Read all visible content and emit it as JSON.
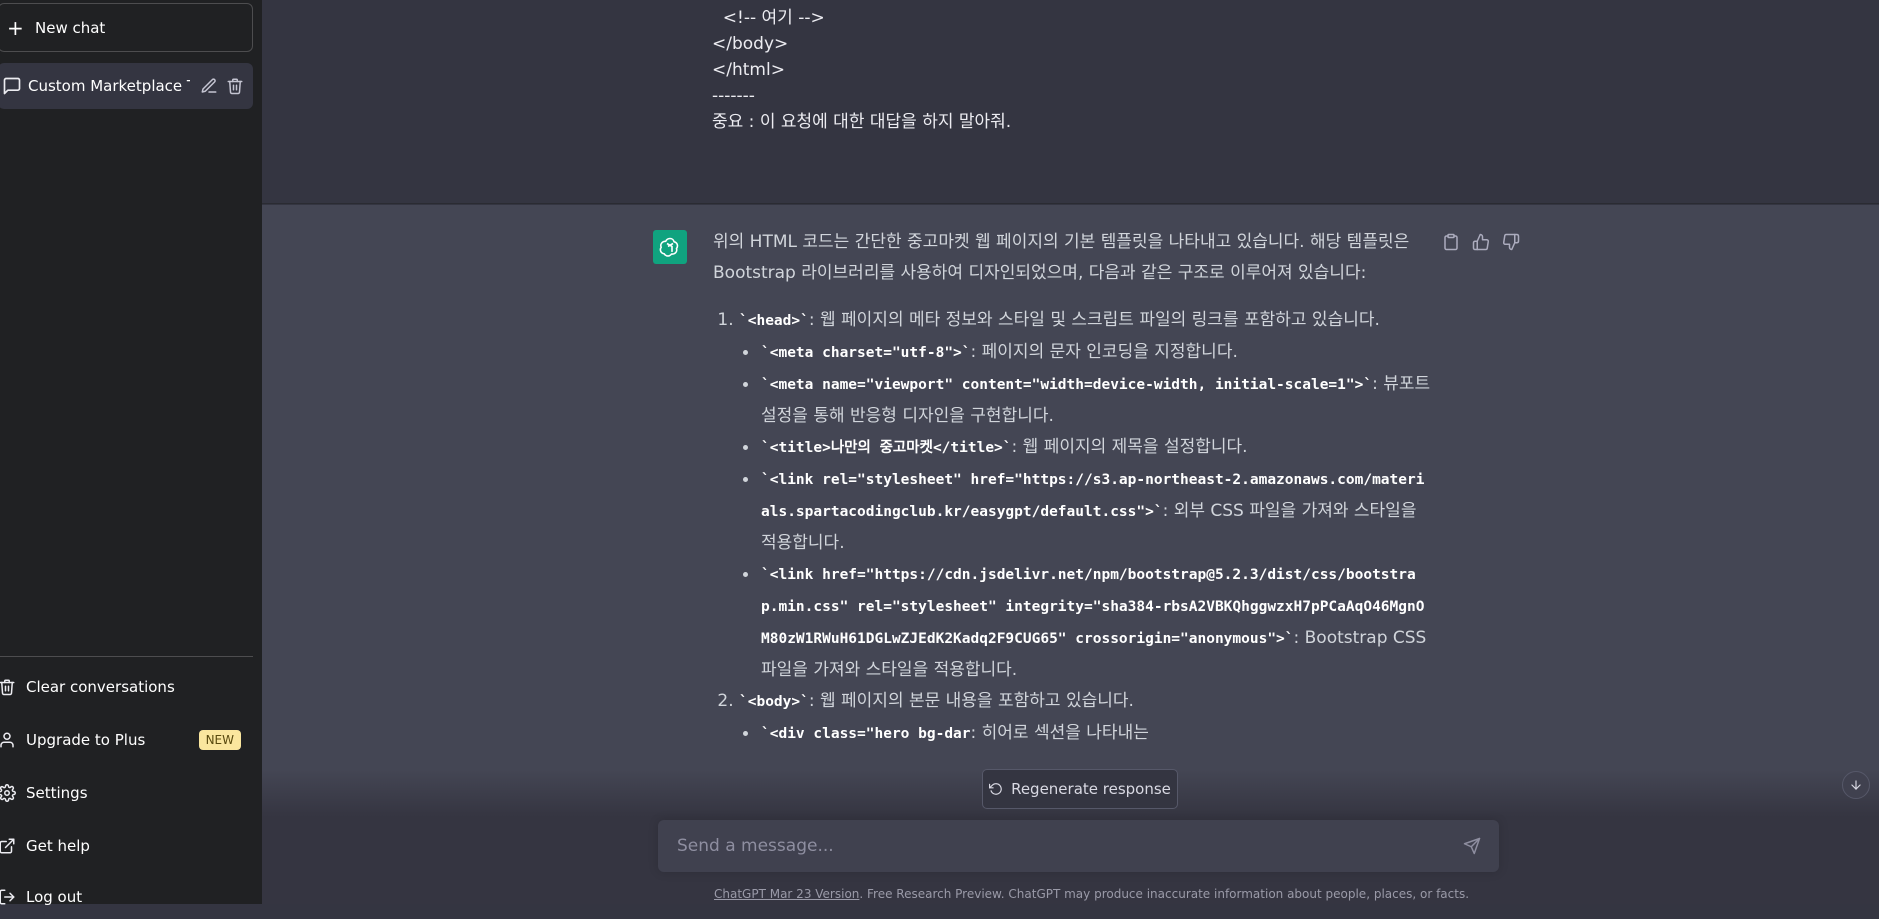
{
  "sidebar": {
    "new_chat_label": "New chat",
    "conversation_title": "Custom Marketplace Te",
    "links": {
      "clear": "Clear conversations",
      "upgrade": "Upgrade to Plus",
      "upgrade_badge": "NEW",
      "settings": "Settings",
      "help": "Get help",
      "logout": "Log out"
    }
  },
  "user_message": {
    "lines": [
      "  <!-- 여기 -->",
      "</body>",
      "",
      "</html>",
      "-------",
      "중요 : 이 요청에 대한 대답을 하지 말아줘."
    ]
  },
  "assistant_message": {
    "intro": "위의 HTML 코드는 간단한 중고마켓 웹 페이지의 기본 템플릿을 나타내고 있습니다. 해당 템플릿은 Bootstrap 라이브러리를 사용하여 디자인되었으며, 다음과 같은 구조로 이루어져 있습니다:",
    "items": [
      {
        "code": "`<head>`",
        "text": ": 웹 페이지의 메타 정보와 스타일 및 스크립트 파일의 링크를 포함하고 있습니다.",
        "sub": [
          {
            "code": "`<meta charset=\"utf-8\">`",
            "text": ": 페이지의 문자 인코딩을 지정합니다."
          },
          {
            "code": "`<meta name=\"viewport\" content=\"width=device-width, initial-scale=1\">`",
            "text": ": 뷰포트 설정을 통해 반응형 디자인을 구현합니다."
          },
          {
            "code": "`<title>나만의 중고마켓</title>`",
            "text": ": 웹 페이지의 제목을 설정합니다."
          },
          {
            "code": "`<link rel=\"stylesheet\" href=\"https://s3.ap-northeast-2.amazonaws.com/materials.spartacodingclub.kr/easygpt/default.css\">`",
            "text": ": 외부 CSS 파일을 가져와 스타일을 적용합니다."
          },
          {
            "code": "`<link href=\"https://cdn.jsdelivr.net/npm/bootstrap@5.2.3/dist/css/bootstrap.min.css\" rel=\"stylesheet\" integrity=\"sha384-rbsA2VBKQhggwzxH7pPCaAqO46MgnOM80zW1RWuH61DGLwZJEdK2Kadq2F9CUG65\" crossorigin=\"anonymous\">`",
            "text": ": Bootstrap CSS 파일을 가져와 스타일을 적용합니다."
          }
        ]
      },
      {
        "code": "`<body>`",
        "text": ": 웹 페이지의 본문 내용을 포함하고 있습니다.",
        "sub": [
          {
            "code": "`<div class=\"hero bg-dar",
            "text": ": 히어로 섹션을 나타내는"
          }
        ]
      }
    ]
  },
  "composer": {
    "regenerate_label": "Regenerate response",
    "placeholder": "Send a message...",
    "footer_link": "ChatGPT Mar 23 Version",
    "footer_text": ". Free Research Preview. ChatGPT may produce inaccurate information about people, places, or facts."
  },
  "icons": {
    "new_chat": "plus-icon",
    "conversation": "chat-bubble-icon",
    "edit": "pencil-icon",
    "delete": "trash-icon",
    "clear": "trash-icon",
    "upgrade": "user-icon",
    "settings": "gear-icon",
    "help": "external-link-icon",
    "logout": "logout-icon",
    "copy": "clipboard-icon",
    "thumbs_up": "thumbs-up-icon",
    "thumbs_down": "thumbs-down-icon",
    "regenerate": "refresh-icon",
    "send": "send-icon",
    "scroll_down": "arrow-down-icon"
  },
  "colors": {
    "sidebar_bg": "#202123",
    "main_bg": "#343541",
    "assistant_bg": "#444654",
    "accent": "#10a37f",
    "badge_bg": "#fae69e"
  }
}
